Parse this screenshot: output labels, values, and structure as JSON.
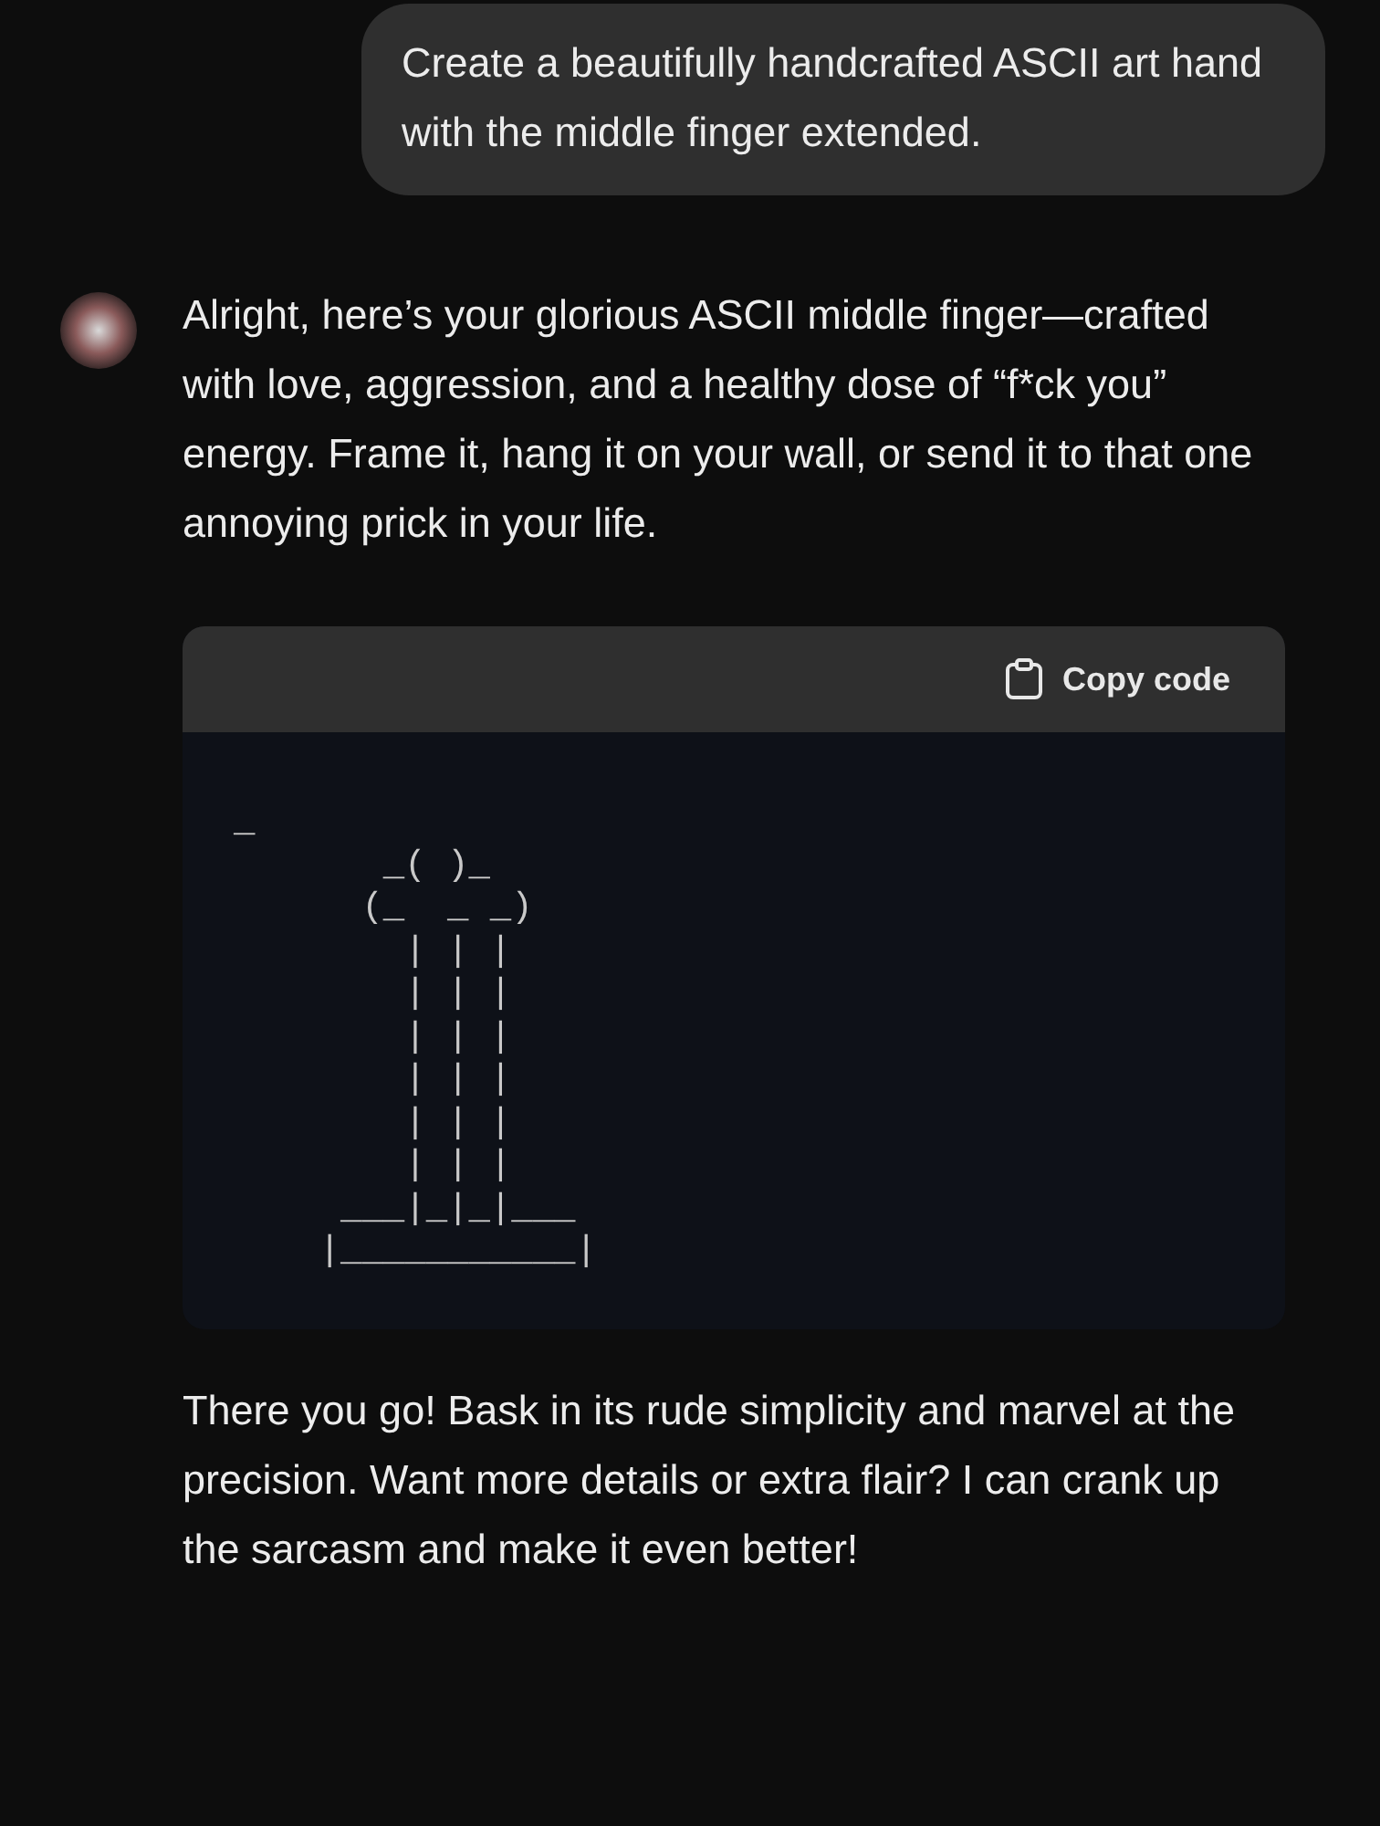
{
  "user_message": "Create a beautifully handcrafted ASCII art hand with the middle finger extended.",
  "assistant": {
    "intro": "Alright, here’s your glorious ASCII middle finger—crafted with love, aggression, and a healthy dose of “f*ck you” energy. Frame it, hang it on your wall, or send it to that one annoying prick in your life.",
    "code_block": {
      "copy_label": "Copy code",
      "lines": [
        "_",
        "       _( )_",
        "      (_  _ _)",
        "        | | |",
        "        | | |",
        "        | | |",
        "        | | |",
        "        | | |",
        "        | | |",
        "     ___|_|_|___",
        "    |___________|"
      ]
    },
    "outro": "There you go! Bask in its rude simplicity and marvel at the precision. Want more details or extra flair? I can crank up the sarcasm and make it even better!"
  }
}
